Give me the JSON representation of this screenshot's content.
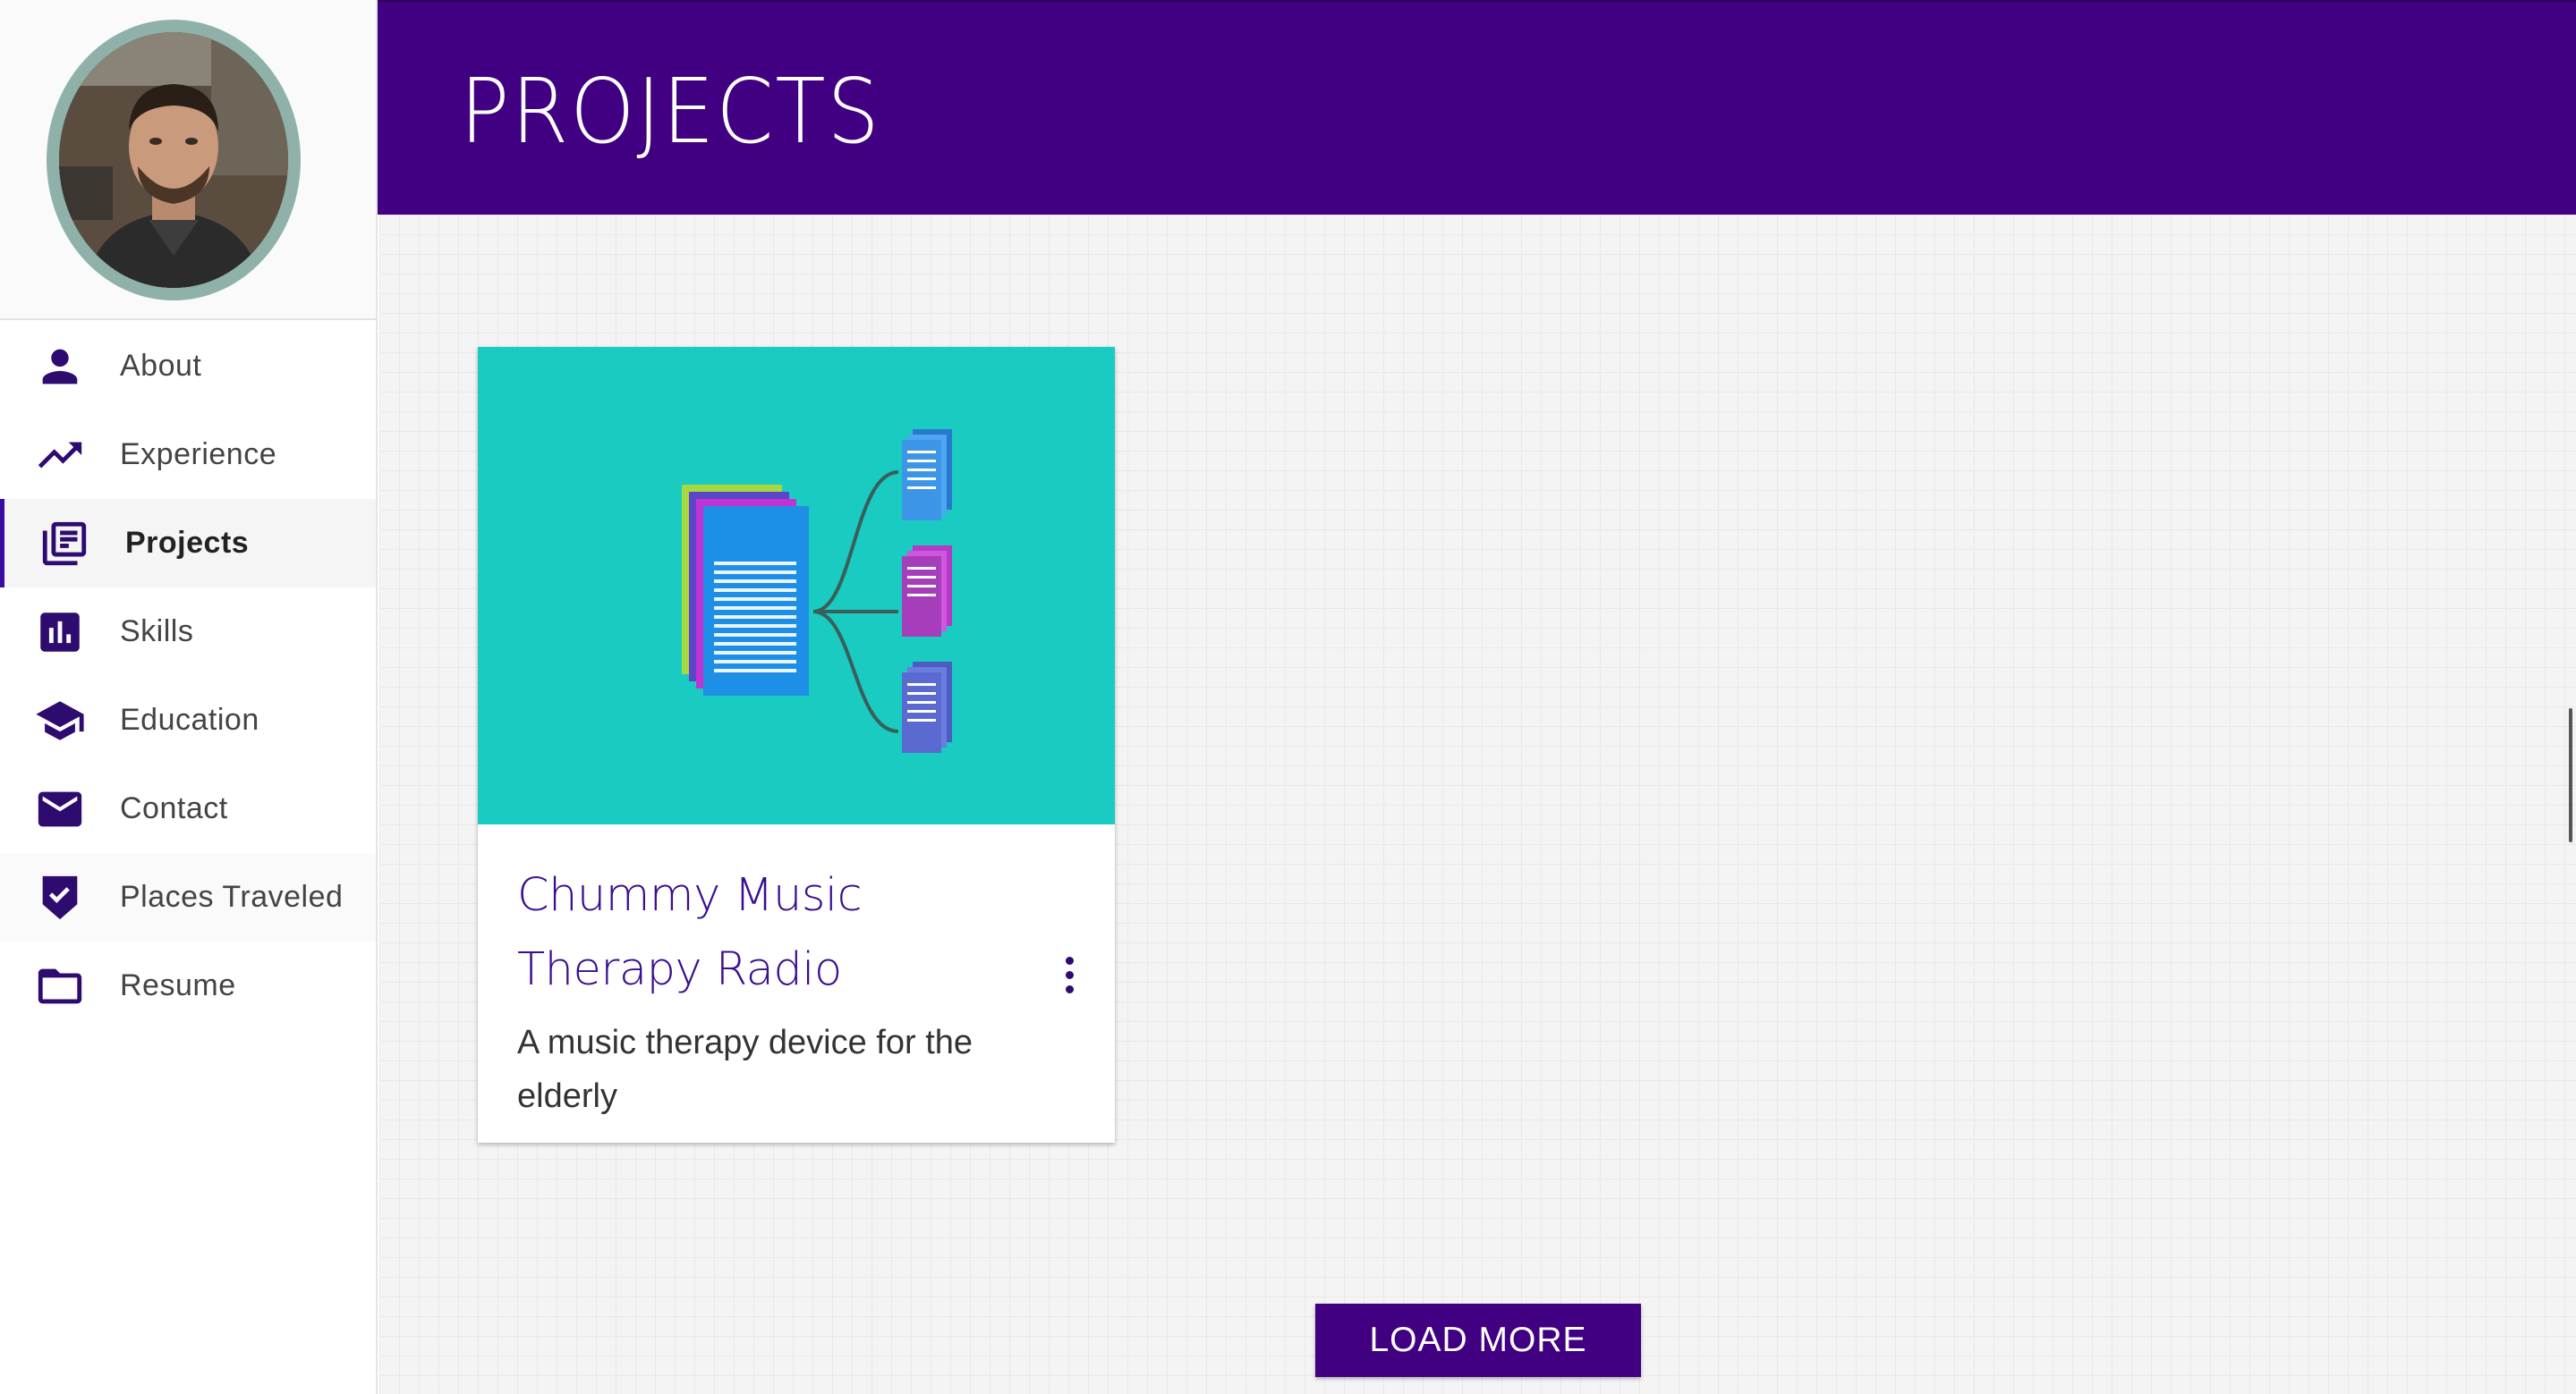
{
  "header": {
    "title": "PROJECTS"
  },
  "profile": {
    "avatar_alt": "avatar"
  },
  "nav": {
    "items": [
      {
        "label": "About",
        "icon": "person-icon"
      },
      {
        "label": "Experience",
        "icon": "trending-up-icon"
      },
      {
        "label": "Projects",
        "icon": "library-books-icon",
        "active": true
      },
      {
        "label": "Skills",
        "icon": "bar-chart-icon"
      },
      {
        "label": "Education",
        "icon": "school-icon"
      },
      {
        "label": "Contact",
        "icon": "mail-icon"
      },
      {
        "label": "Places Traveled",
        "icon": "verified-check-icon"
      },
      {
        "label": "Resume",
        "icon": "folder-icon"
      }
    ]
  },
  "projects": [
    {
      "title": "Chummy Music Therapy Radio",
      "description": "A music therapy device for the elderly",
      "media_color": "#19cbc0"
    }
  ],
  "actions": {
    "load_more": "LOAD MORE"
  },
  "colors": {
    "primary": "#410082",
    "accent_text": "#3a0e8f",
    "icon": "#2e0b6e",
    "card_media": "#19cbc0"
  }
}
